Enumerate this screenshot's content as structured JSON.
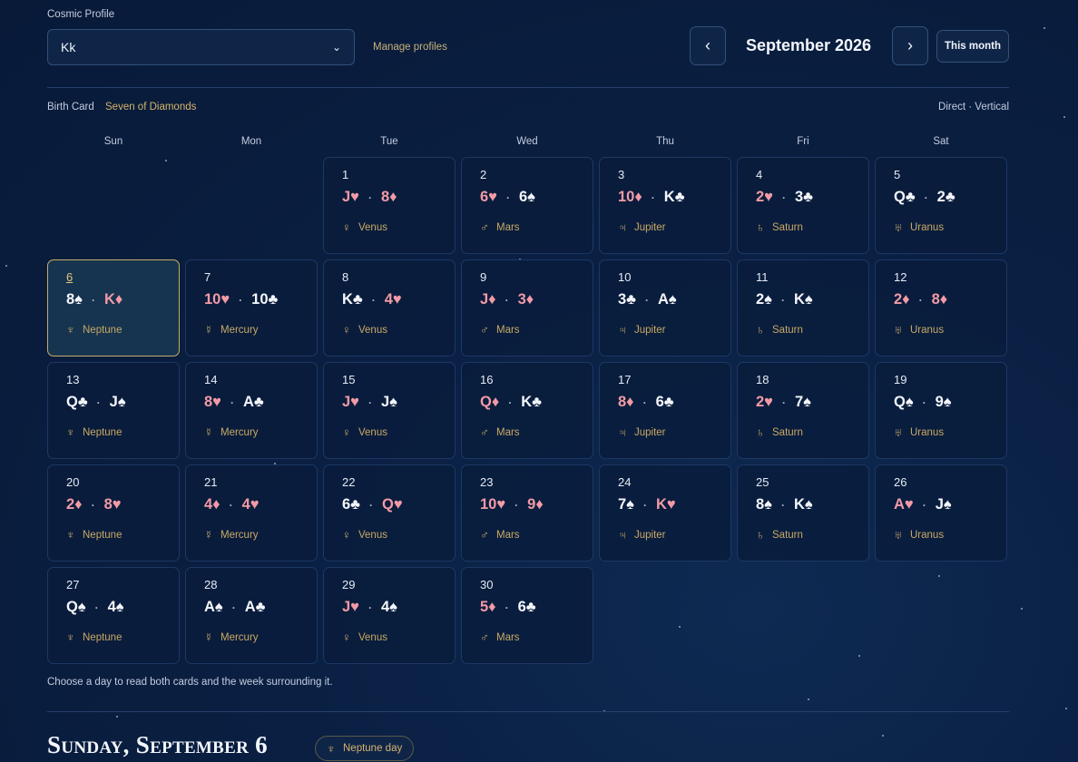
{
  "header": {
    "profile_label": "Cosmic Profile",
    "profile_value": "Kk",
    "manage_label": "Manage profiles",
    "prev_label": "‹",
    "next_label": "›",
    "month_title": "September 2026",
    "this_month_label": "This month"
  },
  "birth": {
    "label": "Birth Card",
    "value": "Seven of Diamonds",
    "mode": "Direct · Vertical"
  },
  "weekdays": [
    "Sun",
    "Mon",
    "Tue",
    "Wed",
    "Thu",
    "Fri",
    "Sat"
  ],
  "days": [
    {
      "n": "1",
      "c1": "J♥",
      "c2": "8♦",
      "planet": "Venus"
    },
    {
      "n": "2",
      "c1": "6♥",
      "c2": "6♠",
      "planet": "Mars"
    },
    {
      "n": "3",
      "c1": "10♦",
      "c2": "K♣",
      "planet": "Jupiter"
    },
    {
      "n": "4",
      "c1": "2♥",
      "c2": "3♣",
      "planet": "Saturn"
    },
    {
      "n": "5",
      "c1": "Q♣",
      "c2": "2♣",
      "planet": "Uranus"
    },
    {
      "n": "6",
      "c1": "8♠",
      "c2": "K♦",
      "planet": "Neptune"
    },
    {
      "n": "7",
      "c1": "10♥",
      "c2": "10♣",
      "planet": "Mercury"
    },
    {
      "n": "8",
      "c1": "K♣",
      "c2": "4♥",
      "planet": "Venus"
    },
    {
      "n": "9",
      "c1": "J♦",
      "c2": "3♦",
      "planet": "Mars"
    },
    {
      "n": "10",
      "c1": "3♣",
      "c2": "A♠",
      "planet": "Jupiter"
    },
    {
      "n": "11",
      "c1": "2♠",
      "c2": "K♠",
      "planet": "Saturn"
    },
    {
      "n": "12",
      "c1": "2♦",
      "c2": "8♦",
      "planet": "Uranus"
    },
    {
      "n": "13",
      "c1": "Q♣",
      "c2": "J♠",
      "planet": "Neptune"
    },
    {
      "n": "14",
      "c1": "8♥",
      "c2": "A♣",
      "planet": "Mercury"
    },
    {
      "n": "15",
      "c1": "J♥",
      "c2": "J♠",
      "planet": "Venus"
    },
    {
      "n": "16",
      "c1": "Q♦",
      "c2": "K♣",
      "planet": "Mars"
    },
    {
      "n": "17",
      "c1": "8♦",
      "c2": "6♣",
      "planet": "Jupiter"
    },
    {
      "n": "18",
      "c1": "2♥",
      "c2": "7♠",
      "planet": "Saturn"
    },
    {
      "n": "19",
      "c1": "Q♠",
      "c2": "9♠",
      "planet": "Uranus"
    },
    {
      "n": "20",
      "c1": "2♦",
      "c2": "8♥",
      "planet": "Neptune"
    },
    {
      "n": "21",
      "c1": "4♦",
      "c2": "4♥",
      "planet": "Mercury"
    },
    {
      "n": "22",
      "c1": "6♣",
      "c2": "Q♥",
      "planet": "Venus"
    },
    {
      "n": "23",
      "c1": "10♥",
      "c2": "9♦",
      "planet": "Mars"
    },
    {
      "n": "24",
      "c1": "7♠",
      "c2": "K♥",
      "planet": "Jupiter"
    },
    {
      "n": "25",
      "c1": "8♠",
      "c2": "K♠",
      "planet": "Saturn"
    },
    {
      "n": "26",
      "c1": "A♥",
      "c2": "J♠",
      "planet": "Uranus"
    },
    {
      "n": "27",
      "c1": "Q♠",
      "c2": "4♠",
      "planet": "Neptune"
    },
    {
      "n": "28",
      "c1": "A♠",
      "c2": "A♣",
      "planet": "Mercury"
    },
    {
      "n": "29",
      "c1": "J♥",
      "c2": "4♠",
      "planet": "Venus"
    },
    {
      "n": "30",
      "c1": "5♦",
      "c2": "6♣",
      "planet": "Mars"
    }
  ],
  "selected_day": "6",
  "planet_glyphs": {
    "Venus": "♀",
    "Mars": "♂",
    "Jupiter": "♃",
    "Saturn": "♄",
    "Uranus": "♅",
    "Neptune": "♆",
    "Mercury": "☿"
  },
  "hint": "Choose a day to read both cards and the week surrounding it.",
  "detail": {
    "heading": "Sunday, September 6",
    "badge": "Neptune day",
    "badge_glyph": "♆"
  },
  "colors": {
    "red_suit": "#f29aa6",
    "black_suit": "#f4f6fb",
    "accent_gold": "#c9a964"
  }
}
